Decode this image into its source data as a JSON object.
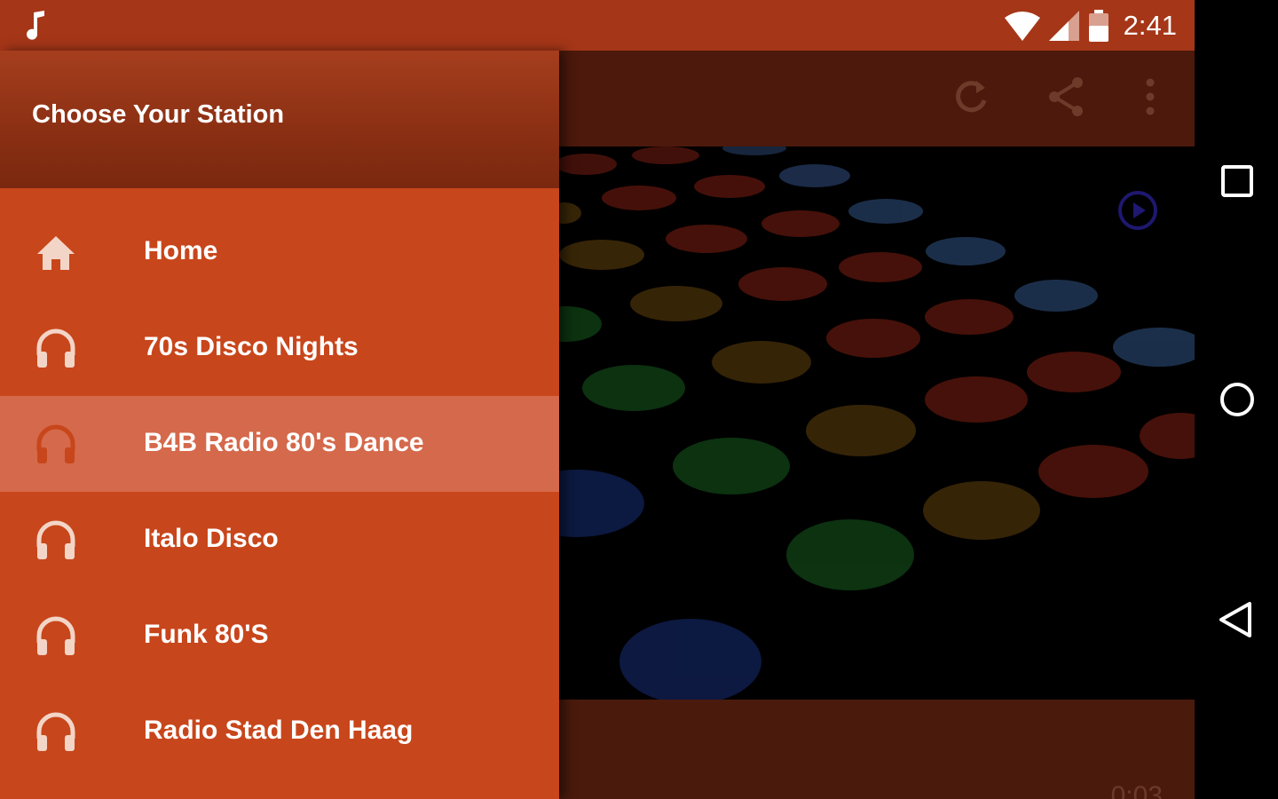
{
  "status_bar": {
    "time": "2:41",
    "icons": [
      "music-note-icon",
      "wifi-icon",
      "cell-signal-icon",
      "battery-icon"
    ]
  },
  "drawer": {
    "title": "Choose Your Station",
    "items": [
      {
        "label": "Home",
        "icon": "home-icon"
      },
      {
        "label": "70s Disco Nights",
        "icon": "headphones-icon"
      },
      {
        "label": "B4B Radio 80's Dance",
        "icon": "headphones-icon",
        "selected": true
      },
      {
        "label": "Italo Disco",
        "icon": "headphones-icon"
      },
      {
        "label": "Funk 80'S",
        "icon": "headphones-icon"
      },
      {
        "label": "Radio Stad Den Haag",
        "icon": "headphones-icon"
      }
    ]
  },
  "toolbar": {
    "icons": [
      "refresh-icon",
      "share-icon",
      "more-vert-icon"
    ]
  },
  "player": {
    "elapsed": "0:03"
  },
  "navigation_bar": {
    "icons": [
      "recents-square-icon",
      "home-circle-icon",
      "back-triangle-icon"
    ]
  },
  "colors": {
    "primary": "#c8461b",
    "status_bar": "#a53618",
    "selected_item": "#d5694b",
    "toolbar_dimmed": "#4c190c"
  }
}
